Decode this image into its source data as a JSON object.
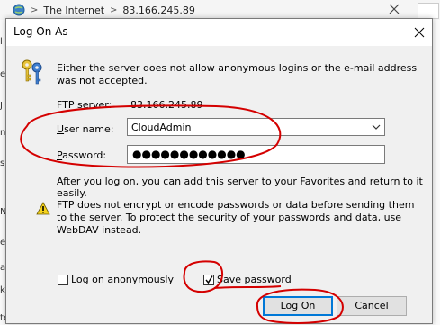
{
  "background": {
    "breadcrumb_sep": ">",
    "location": "The Internet",
    "address": "83.166.245.89",
    "left_fragments": [
      "l",
      "e",
      "J",
      "n",
      "s",
      "N",
      "e",
      "a",
      "k",
      "ten"
    ]
  },
  "dialog": {
    "title": "Log On As",
    "intro": "Either the server does not allow anonymous logins or the e-mail address was not accepted.",
    "ftp_server_label": "FTP server:",
    "ftp_server_value": "83.166.245.89",
    "user_label_u": "U",
    "user_label_rest": "ser name:",
    "user_value": "CloudAdmin",
    "password_label_p": "P",
    "password_label_rest": "assword:",
    "password_mask": "●●●●●●●●●●●●",
    "after_text": "After you log on, you can add this server to your Favorites and return to it easily.",
    "warning_text": "FTP does not encrypt or encode passwords or data before sending them to the server.  To protect the security of your passwords and data, use WebDAV instead.",
    "anon_label_pre": "Log on ",
    "anon_label_a": "a",
    "anon_label_rest": "nonymously",
    "anon_checked": false,
    "save_label_s": "S",
    "save_label_rest": "ave password",
    "save_checked": true,
    "logon_button": "Log On",
    "cancel_button": "Cancel"
  },
  "icons": {
    "title_close": "close-icon",
    "keys": "keys-icon",
    "warning": "warning-icon",
    "combo_arrow": "chevron-down-icon"
  },
  "colors": {
    "annotation": "#d40000",
    "focus": "#0078d7"
  }
}
